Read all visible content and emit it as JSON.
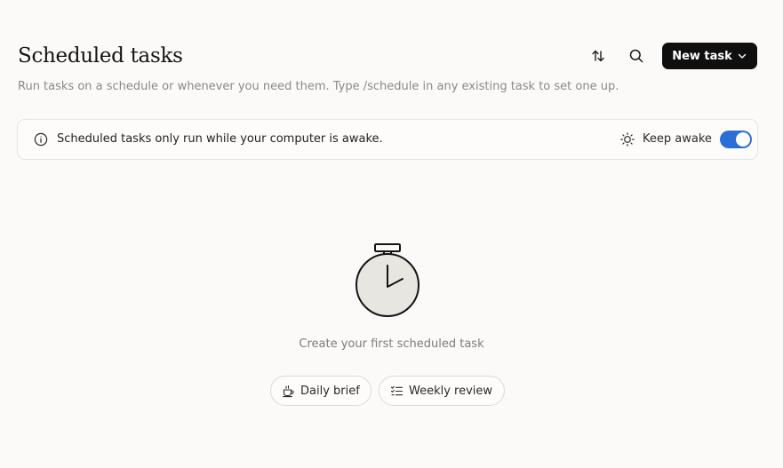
{
  "header": {
    "title": "Scheduled tasks",
    "subtitle": "Run tasks on a schedule or whenever you need them. Type /schedule in any existing task to set one up.",
    "new_task_label": "New task"
  },
  "toolbar": {
    "sort_icon": "sort-arrows-icon",
    "search_icon": "search-icon",
    "new_task_icon": "chevron-down-icon"
  },
  "banner": {
    "icon": "info-icon",
    "message": "Scheduled tasks only run while your computer is awake.",
    "keep_awake_icon": "sun-icon",
    "keep_awake_label": "Keep awake",
    "keep_awake_enabled": true
  },
  "empty_state": {
    "illustration": "stopwatch-icon",
    "message": "Create your first scheduled task",
    "suggestions": [
      {
        "label": "Daily brief",
        "icon": "coffee-cup-icon"
      },
      {
        "label": "Weekly review",
        "icon": "checklist-icon"
      }
    ]
  },
  "colors": {
    "background": "#fbfaf8",
    "primary_button": "#0f0f0f",
    "toggle_on": "#2b6fd6",
    "muted_text": "#8a8985"
  }
}
